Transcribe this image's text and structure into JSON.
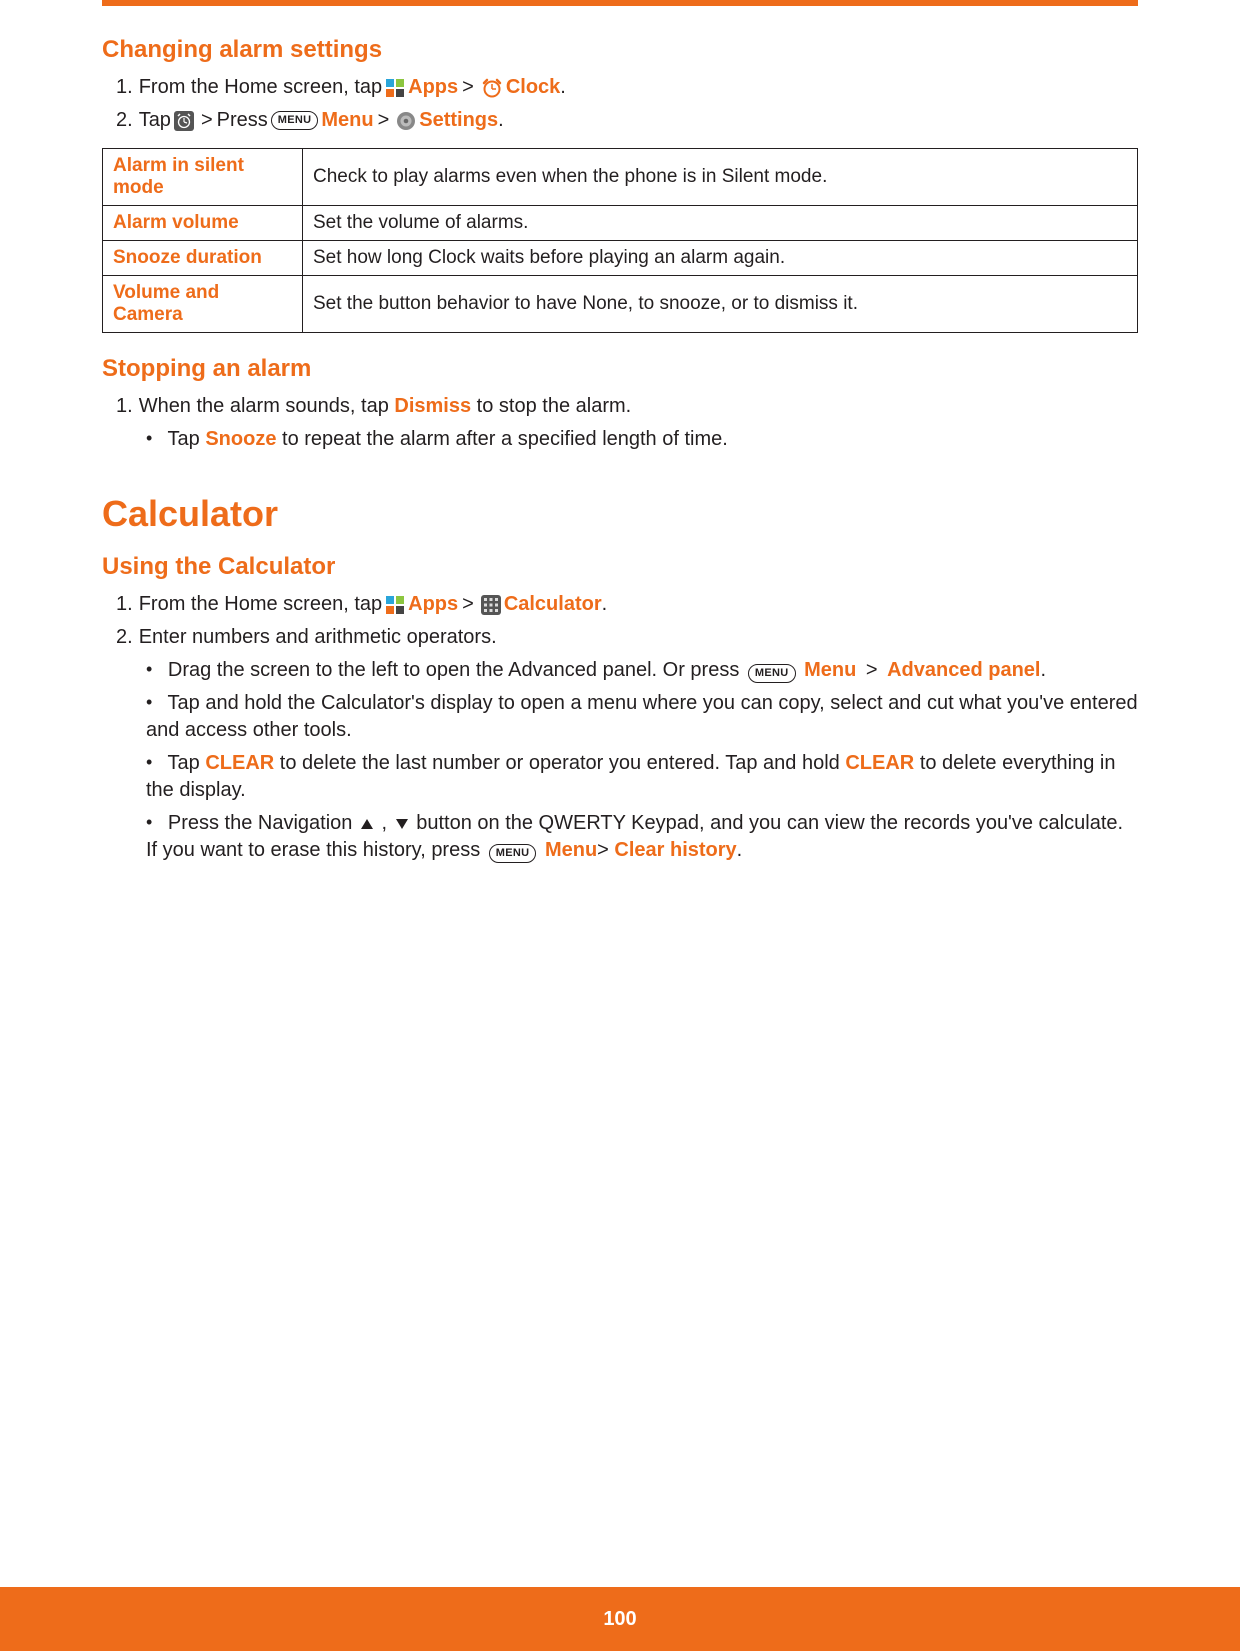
{
  "page_number": "100",
  "sections": {
    "changing_alarm": {
      "title": "Changing alarm settings",
      "step1_a": "From the Home screen, tap",
      "step1_apps": "Apps",
      "step1_clock": "Clock",
      "step2_a": "Tap",
      "step2_press": "Press",
      "step2_menu": "Menu",
      "step2_settings": "Settings",
      "table": [
        {
          "k": "Alarm in silent mode",
          "v": "Check to play alarms even when the phone is in Silent mode."
        },
        {
          "k": "Alarm volume",
          "v": "Set the volume of alarms."
        },
        {
          "k": "Snooze duration",
          "v": "Set how long Clock waits before playing an alarm again."
        },
        {
          "k": "Volume and Camera",
          "v": "Set the button behavior to have None, to snooze, or to dismiss it."
        }
      ]
    },
    "stopping_alarm": {
      "title": "Stopping an alarm",
      "step1_a": "When the alarm sounds, tap",
      "step1_dismiss": "Dismiss",
      "step1_b": "to stop the alarm.",
      "bullet1_a": "Tap",
      "bullet1_snooze": "Snooze",
      "bullet1_b": "to repeat the alarm after a specified length of time."
    },
    "calculator": {
      "title": "Calculator",
      "subtitle": "Using the Calculator",
      "step1_a": "From the Home screen, tap",
      "step1_apps": "Apps",
      "step1_calc": "Calculator",
      "step2": "Enter numbers and arithmetic operators.",
      "b1_a": "Drag the screen to the left to open the Advanced panel. Or press",
      "b1_menu": "Menu",
      "b1_adv": "Advanced panel",
      "b2": "Tap and hold the Calculator's display to open a menu where you can copy, select and cut what you've entered and access other tools.",
      "b3_a": "Tap",
      "b3_clear": "CLEAR",
      "b3_b": "to delete the last number or operator you entered. Tap and hold",
      "b3_c": "to delete everything in the display.",
      "b4_a": "Press the Navigation",
      "b4_b": "button on the QWERTY Keypad, and you can view the records you've calculate. If you want to erase this history, press",
      "b4_menu": "Menu",
      "b4_clear_history": "Clear history"
    }
  },
  "labels": {
    "menu_key": "menu",
    "gt": ">",
    "period": ".",
    "comma": ",",
    "num1": "1.",
    "num2": "2."
  }
}
